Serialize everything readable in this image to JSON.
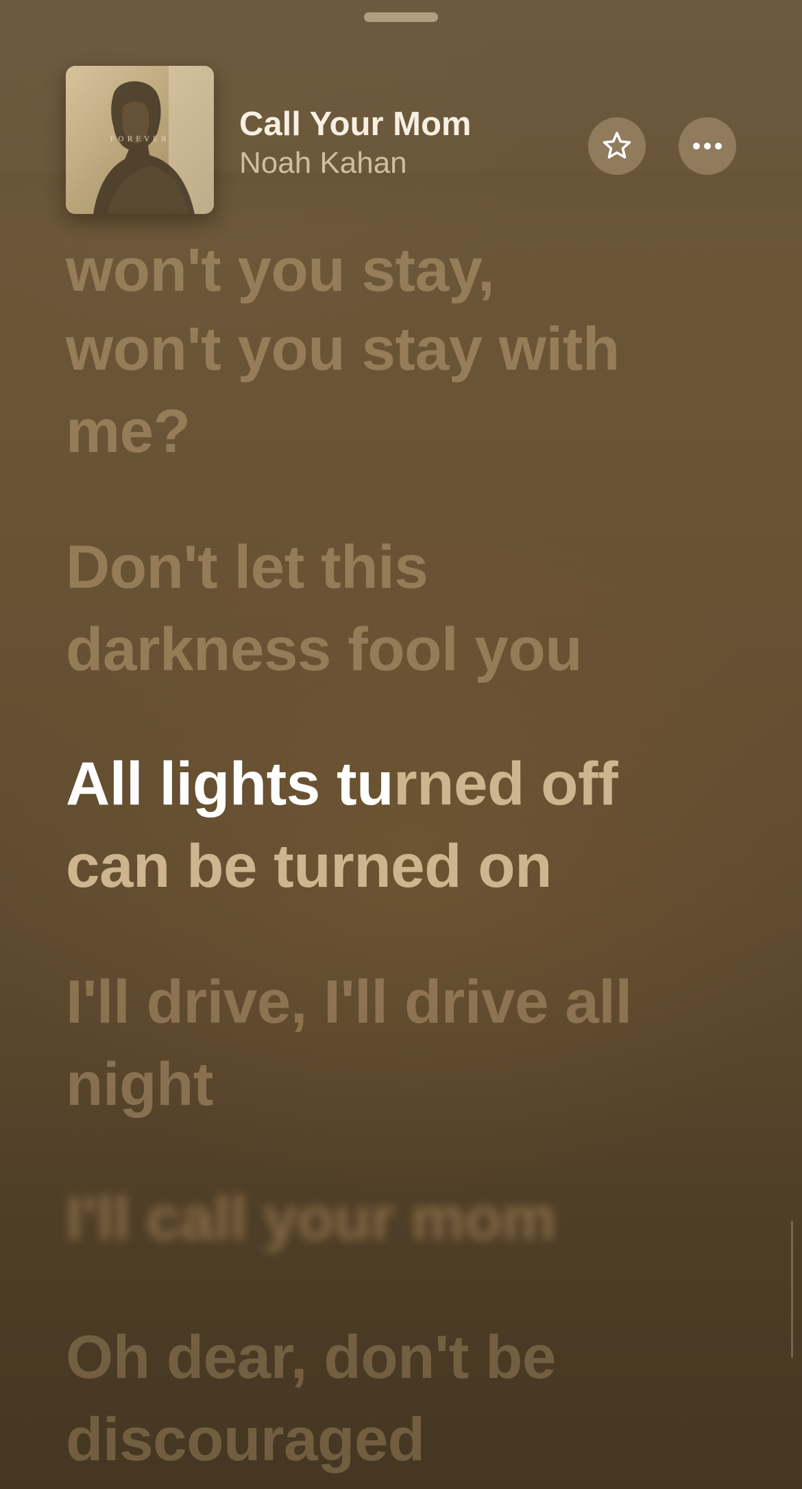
{
  "now_playing": {
    "title": "Call Your Mom",
    "artist": "Noah Kahan",
    "artwork_text": "FOREVER"
  },
  "controls": {
    "favorite_icon": "star-icon",
    "more_icon": "ellipsis-icon"
  },
  "lyrics": [
    {
      "state": "past",
      "lines": [
        "won't you stay,"
      ]
    },
    {
      "state": "past",
      "lines": [
        "won't you stay with",
        "me?"
      ]
    },
    {
      "state": "past",
      "lines": [
        "Don't let this",
        "darkness fool you"
      ]
    },
    {
      "state": "current",
      "line1_sung": "All lights tu",
      "line1_rest": "rned off",
      "line2": "can be turned on"
    },
    {
      "state": "upcoming",
      "lines": [
        "I'll drive, I'll drive all",
        "night"
      ]
    },
    {
      "state": "blurred",
      "lines": [
        "I'll call your mom"
      ]
    },
    {
      "state": "upcoming",
      "lines": [
        "Oh dear, don't be",
        "discouraged"
      ]
    }
  ],
  "colors": {
    "background_top": "#6b5a40",
    "background_bottom": "#453622",
    "lyric_active": "#ffffff",
    "lyric_inactive": "#b09670"
  }
}
